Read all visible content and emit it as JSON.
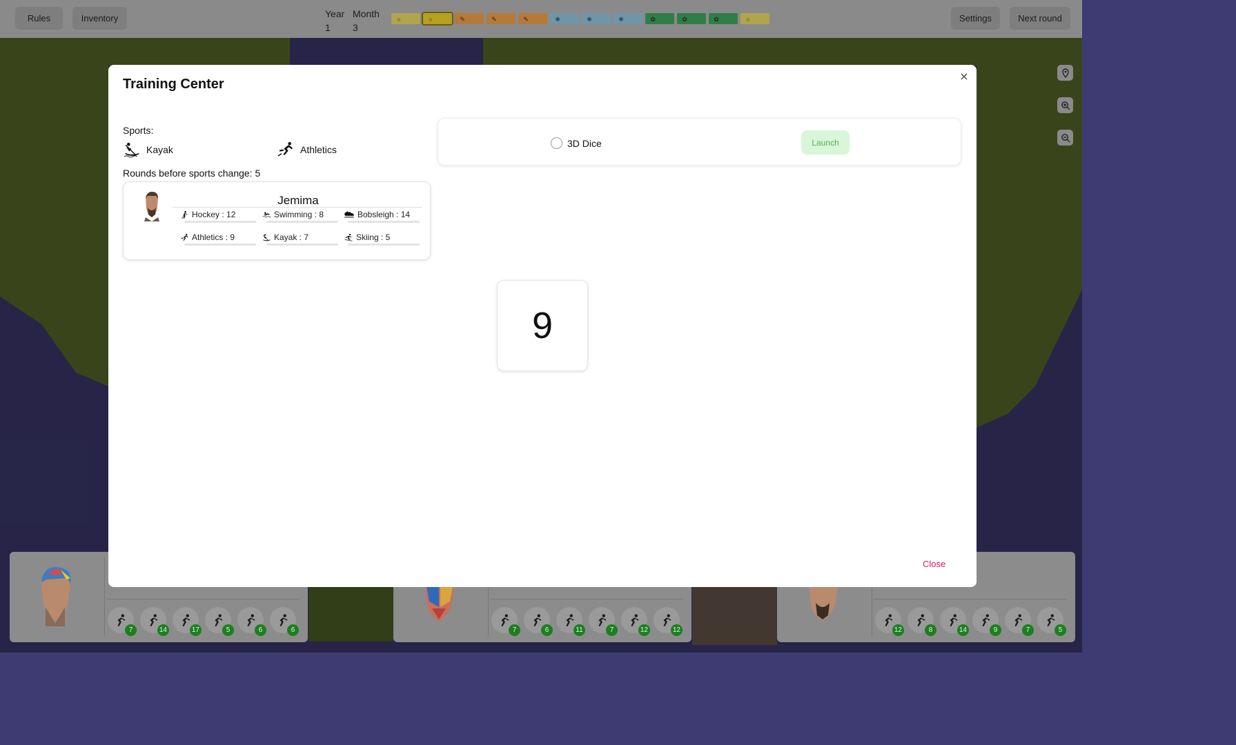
{
  "topbar": {
    "rules_label": "Rules",
    "inventory_label": "Inventory",
    "year_label": "Year",
    "year_value": "1",
    "month_label": "Month",
    "month_value": "3",
    "settings_label": "Settings",
    "next_round_label": "Next round",
    "timeline": [
      {
        "season": "summer",
        "color": "#b0a54a",
        "icon": "sun-icon"
      },
      {
        "season": "summer",
        "color": "#b6a020",
        "icon": "sun-icon",
        "current": true
      },
      {
        "season": "autumn",
        "color": "#b5793a",
        "icon": "leaf-icon"
      },
      {
        "season": "autumn",
        "color": "#b5793a",
        "icon": "leaf-icon"
      },
      {
        "season": "autumn",
        "color": "#b5793a",
        "icon": "leaf-icon"
      },
      {
        "season": "winter",
        "color": "#6f95a8",
        "icon": "snowflake-icon"
      },
      {
        "season": "winter",
        "color": "#6f95a8",
        "icon": "snowflake-icon"
      },
      {
        "season": "winter",
        "color": "#6f95a8",
        "icon": "snowflake-icon"
      },
      {
        "season": "spring",
        "color": "#2f7d48",
        "icon": "flower-icon"
      },
      {
        "season": "spring",
        "color": "#2f7d48",
        "icon": "flower-icon"
      },
      {
        "season": "spring",
        "color": "#2f7d48",
        "icon": "flower-icon"
      },
      {
        "season": "summer",
        "color": "#b0a54a",
        "icon": "sun-icon"
      }
    ]
  },
  "modal": {
    "title": "Training Center",
    "close_x": "×",
    "sports_label": "Sports:",
    "sports": [
      {
        "name": "Kayak",
        "icon": "kayak-icon"
      },
      {
        "name": "Athletics",
        "icon": "athletics-icon"
      }
    ],
    "rounds_text": "Rounds before sports change: 5",
    "athlete": {
      "name": "Jemima",
      "skills": [
        {
          "label": "Hockey : 12",
          "icon": "hockey-icon"
        },
        {
          "label": "Swimming : 8",
          "icon": "swimming-icon"
        },
        {
          "label": "Bobsleigh : 14",
          "icon": "bobsleigh-icon"
        },
        {
          "label": "Athletics : 9",
          "icon": "athletics-icon"
        },
        {
          "label": "Kayak : 7",
          "icon": "kayak-icon"
        },
        {
          "label": "Skiing : 5",
          "icon": "skiing-icon"
        }
      ]
    },
    "dice_option_label": "3D Dice",
    "launch_label": "Launch",
    "dice_result": "9",
    "close_label": "Close"
  },
  "players": [
    {
      "stats": [
        "7",
        "14",
        "17",
        "5",
        "6",
        "6"
      ]
    },
    {
      "stats": [
        "7",
        "6",
        "11",
        "7",
        "12",
        "12"
      ]
    },
    {
      "stats": [
        "12",
        "8",
        "14",
        "9",
        "7",
        "5"
      ]
    }
  ],
  "colors": {
    "launch_bg": "#d9f6d9",
    "launch_text": "#52b352",
    "close_text": "#e0156b",
    "badge": "#1e7e1e"
  }
}
